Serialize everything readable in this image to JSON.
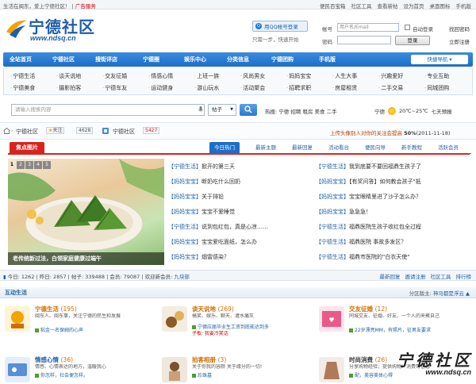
{
  "topbar": {
    "left_text": "生活在闽东，爱上宁德社区！",
    "ad_link": "广告服务",
    "right_links": [
      "便民百宝箱",
      "社区工具",
      "查看新帖",
      "设为首页",
      "桌面图标",
      "手机版"
    ]
  },
  "logo": {
    "name": "宁德社区",
    "url": "www.ndsq.cn"
  },
  "login": {
    "qq_button": "用QQ帐号登录",
    "one_step": "只需一步，快速开始",
    "username_label": "帐号",
    "username_placeholder": "用户名/Email",
    "password_label": "密码",
    "auto_login": "自动登录",
    "find_password": "找回密码",
    "login_button": "登录",
    "register": "立即注册"
  },
  "nav": {
    "items": [
      "全站首页",
      "宁德社区",
      "搜街评店",
      "宁德圈",
      "娱乐中心",
      "分类信息",
      "宁德团购",
      "手机版"
    ],
    "quick_nav": "快捷导航 ▾"
  },
  "subnav": {
    "row1": [
      "宁德生活",
      "谈天说地",
      "交友征婚",
      "情感心情",
      "上班一族",
      "风尚男女",
      "妈妈宝宝",
      "人生大事",
      "兴趣爱好",
      "专业互助"
    ],
    "row2": [
      "宁德美食",
      "摄影拍客",
      "宁德车友",
      "运动健身",
      "游山玩水",
      "活动聚会",
      "招聘求职",
      "房屋租赁",
      "二手交易",
      "同城团购"
    ]
  },
  "search": {
    "placeholder": "请输入搜索内容",
    "select": "帖子",
    "hot_label": "热搜:",
    "hot_words": [
      "宁德",
      "招聘",
      "租房",
      "美食",
      "二手"
    ]
  },
  "weather": {
    "city": "宁德",
    "temp": "20℃~25℃",
    "desc": "七天预报"
  },
  "crumb": {
    "home": "宁德社区",
    "follow": "关注",
    "follow_count": "4628",
    "forum": "宁德社区",
    "forum_count": "5427",
    "notice": "上传头像别人对你的关注会提高",
    "notice_pct": "50%",
    "notice_date": "(2011-11-18)"
  },
  "tabs": {
    "focus": "焦点图片",
    "items": [
      "今日热门",
      "最新主题",
      "最新回复",
      "活动看台",
      "便民向导",
      "新手教程",
      "活跃会员"
    ]
  },
  "focus": {
    "pages": [
      "1",
      "2",
      "3",
      "4",
      "5"
    ],
    "caption": "老传统新过法，白领家庭健康过端午"
  },
  "threads_col1": [
    {
      "cat": "【宁德生活】",
      "title": "掀开的第三天"
    },
    {
      "cat": "【妈妈宝宝】",
      "title": "断奶吃什么回奶"
    },
    {
      "cat": "【妈妈宝宝】",
      "title": "关于排铅"
    },
    {
      "cat": "【妈妈宝宝】",
      "title": "宝宝不爱睡觉"
    },
    {
      "cat": "【宁德生活】",
      "title": "说到包红包，真是心凉……"
    },
    {
      "cat": "【妈妈宝宝】",
      "title": "宝宝爱吃面纸，怎么办"
    },
    {
      "cat": "【妈妈宝宝】",
      "title": "烟雷感染？"
    }
  ],
  "threads_col2": [
    {
      "cat": "【宁德生活】",
      "title": "我到底要不要回福鼎生孩子了"
    },
    {
      "cat": "【妈妈宝宝】",
      "title": "【有奖问答】如何教会孩子\"抵"
    },
    {
      "cat": "【妈妈宝宝】",
      "title": "宝宝眼睛里进了沙子怎么办？"
    },
    {
      "cat": "【妈妈宝宝】",
      "title": "急急急！"
    },
    {
      "cat": "【宁德生活】",
      "title": "福鼎医院生孩子收红包全过程"
    },
    {
      "cat": "【宁德生活】",
      "title": "福鼎医院 事故多发区？"
    },
    {
      "cat": "【宁德生活】",
      "title": "福鼎市医院的\"白衣天使\""
    }
  ],
  "stats": {
    "today": "今日: 1262",
    "yesterday": "昨日: 2857",
    "posts": "帖子: 339488",
    "members": "会员: 79087",
    "welcome": "欢迎新会员:",
    "new_member": "九块部",
    "links": [
      "最新回复",
      "邀请注册",
      "社区工具",
      "排行榜"
    ]
  },
  "section": {
    "title": "互动生活",
    "moderator_label": "分区版主:",
    "moderators": "神马都是浮云"
  },
  "forums": [
    {
      "name": "宁德生活",
      "count": "(195)",
      "desc": "闽东人、闽东事，关注宁德的民生和发展",
      "latest": "粘金一名保姆的心声",
      "color": "#d36b00"
    },
    {
      "name": "谈天说地",
      "count": "(269)",
      "desc": "搞笑、娱乐、聊天、灌水痛灰",
      "latest": "宁德应届毕业生工资到底能达到多",
      "sub": "子板: 我要冷笑话",
      "color": "#d36b00"
    },
    {
      "name": "交友征婚",
      "count": "(12)",
      "desc": "同城交友、征婚、好友、一个人的来聚自己",
      "latest": "22岁漂亮MM，有照片，征男友要求",
      "color": "#d36b00"
    },
    {
      "name": "情感心情",
      "count": "(36)",
      "desc": "情感、心情表达的地方，温暖我心",
      "latest": "你怎样，社会便怎样。",
      "color": "#1f5fa8"
    },
    {
      "name": "拍客相册",
      "count": "(3)",
      "desc": "关于你我的容颜 关于缘分的一切!",
      "latest": "珍珠墓",
      "color": "#d36b00"
    },
    {
      "name": "时尚消费",
      "count": "(26)",
      "desc": "分享购物经验，提供购物、消费等信息",
      "latest": "配，美容美体心得",
      "color": "#333"
    }
  ],
  "watermark": {
    "text": "宁德社区",
    "url": "www.ndsq.cn"
  }
}
